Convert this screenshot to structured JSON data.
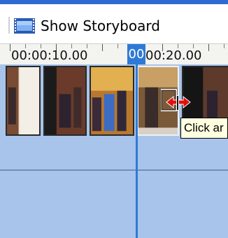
{
  "toolbar": {
    "storyboard_label": "Show Storyboard",
    "icon": "filmstrip-icon"
  },
  "timeline": {
    "time_label_1": "00:00:10.00",
    "time_label_2_highlight": "00",
    "time_label_2_rest": "00:20.00",
    "playhead_color": "#2f79d6",
    "track_color": "#a8c4eb"
  },
  "tooltip": {
    "text": "Click ar"
  }
}
